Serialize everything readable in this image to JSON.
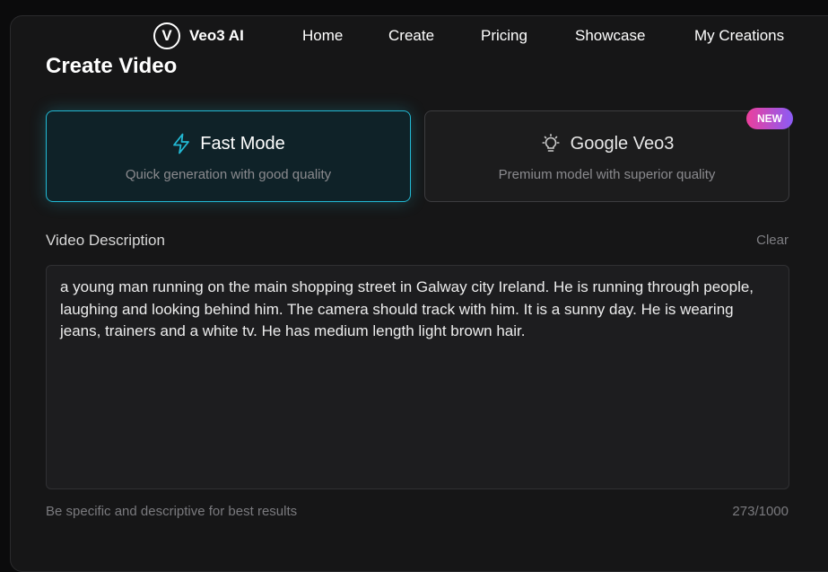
{
  "nav": {
    "logo_letter": "V",
    "brand": "Veo3 AI",
    "links": [
      "Home",
      "Create",
      "Pricing",
      "Showcase",
      "My Creations"
    ]
  },
  "page": {
    "title": "Create Video"
  },
  "modes": [
    {
      "name": "Fast Mode",
      "description": "Quick generation with good quality",
      "icon": "lightning-bolt-icon",
      "selected": true,
      "accent": "#22b9d4"
    },
    {
      "name": "Google Veo3",
      "description": "Premium model with superior quality",
      "icon": "lightbulb-icon",
      "selected": false,
      "badge": "NEW"
    }
  ],
  "description": {
    "label": "Video Description",
    "clear_label": "Clear",
    "value": "a young man running on the main shopping street in Galway city Ireland. He is running through people, laughing and looking behind him. The camera should track with him. It is a sunny day. He is wearing jeans, trainers and a white tv. He has medium length light brown hair.",
    "hint": "Be specific and descriptive for best results",
    "counter": "273/1000"
  }
}
